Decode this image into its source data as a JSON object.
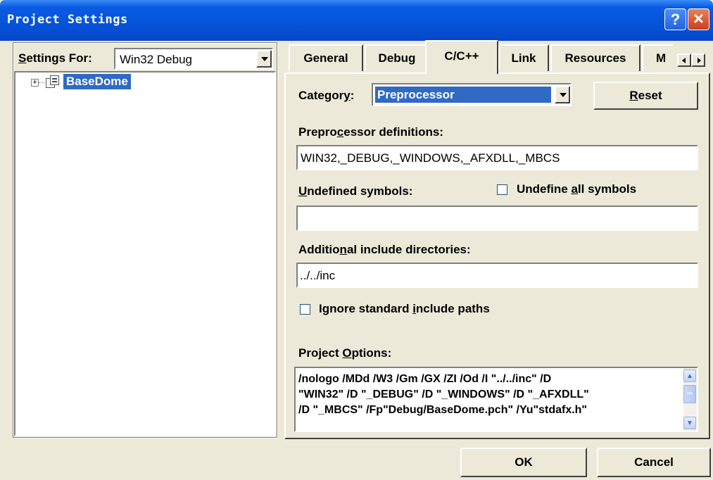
{
  "window": {
    "title": "Project Settings"
  },
  "settings_for": {
    "label_u": "S",
    "label_rest": "ettings For:",
    "value": "Win32 Debug"
  },
  "tree": {
    "root_label": "BaseDome"
  },
  "tabs": [
    {
      "label": "General"
    },
    {
      "label": "Debug"
    },
    {
      "label": "C/C++"
    },
    {
      "label": "Link"
    },
    {
      "label": "Resources"
    },
    {
      "label": "M"
    }
  ],
  "category": {
    "label_a": "Categor",
    "label_u": "y",
    "label_b": ":",
    "value": "Preprocessor"
  },
  "reset_button": {
    "label_u": "R",
    "label_rest": "eset"
  },
  "preproc": {
    "label_a": "Prepro",
    "label_u": "c",
    "label_b": "essor definitions:",
    "value": "WIN32,_DEBUG,_WINDOWS,_AFXDLL,_MBCS"
  },
  "undef": {
    "label_u": "U",
    "label_rest": "ndefined symbols:",
    "value": ""
  },
  "undef_all": {
    "label_a": "Undefine ",
    "label_u": "a",
    "label_b": "ll symbols"
  },
  "include_dirs": {
    "label_a": "Additio",
    "label_u": "n",
    "label_b": "al include directories:",
    "value": "../../inc"
  },
  "ignore_std": {
    "label_a": "Ignore standard ",
    "label_u": "i",
    "label_b": "nclude paths"
  },
  "project_options": {
    "label_a": "Project ",
    "label_u": "O",
    "label_b": "ptions:",
    "lines": [
      "/nologo /MDd /W3 /Gm /GX /ZI /Od /I \"../../inc\" /D",
      "\"WIN32\" /D \"_DEBUG\" /D \"_WINDOWS\" /D \"_AFXDLL\"",
      "/D \"_MBCS\" /Fp\"Debug/BaseDome.pch\" /Yu\"stdafx.h\""
    ]
  },
  "buttons": {
    "ok": "OK",
    "cancel": "Cancel"
  },
  "colors": {
    "title_bar": "#0553d8",
    "selection": "#316ac5",
    "dialog_bg": "#ece9d8"
  }
}
